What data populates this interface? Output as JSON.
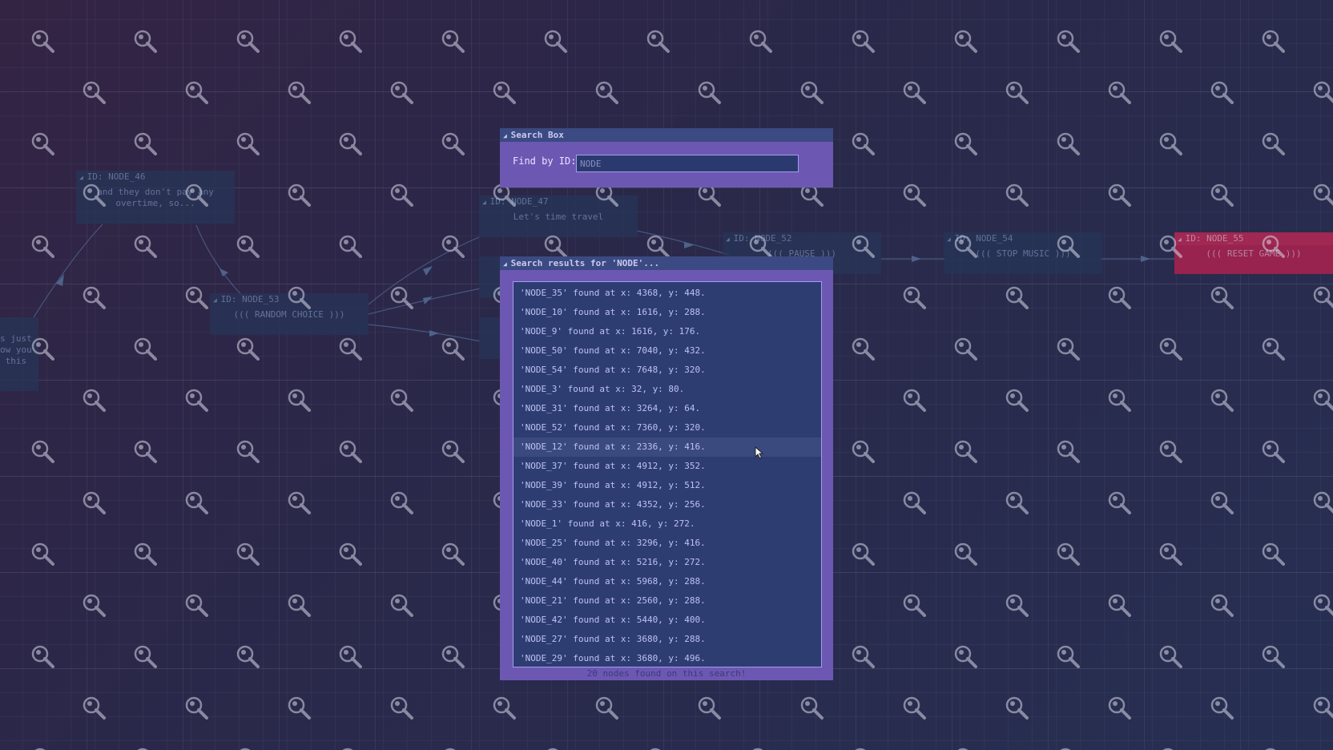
{
  "nodes": [
    {
      "id": "ID: NODE_46",
      "text": "and they don't pay any overtime, so..."
    },
    {
      "id": "ID: NODE_47",
      "text": "Let's time travel"
    },
    {
      "id": "ID: NODE_53",
      "text": "((( RANDOM CHOICE )))"
    },
    {
      "id": "ID: NODE_52",
      "text": "((( PAUSE )))"
    },
    {
      "id": "ID: NODE_54",
      "text": "((( STOP MUSIC )))"
    },
    {
      "id": "ID: NODE_55",
      "text": "((( RESET GAME )))"
    },
    {
      "id": "",
      "text": "s just\now you\n this"
    }
  ],
  "search_box": {
    "title": "Search Box",
    "label": "Find by ID:",
    "value": "NODE"
  },
  "results": {
    "title": "Search results for 'NODE'...",
    "items": [
      "'NODE_35' found at x: 4368, y: 448.",
      "'NODE_10' found at x: 1616, y: 288.",
      "'NODE_9' found at x: 1616, y: 176.",
      "'NODE_50' found at x: 7040, y: 432.",
      "'NODE_54' found at x: 7648, y: 320.",
      "'NODE_3' found at x: 32, y: 80.",
      "'NODE_31' found at x: 3264, y: 64.",
      "'NODE_52' found at x: 7360, y: 320.",
      "'NODE_12' found at x: 2336, y: 416.",
      "'NODE_37' found at x: 4912, y: 352.",
      "'NODE_39' found at x: 4912, y: 512.",
      "'NODE_33' found at x: 4352, y: 256.",
      "'NODE_1' found at x: 416, y: 272.",
      "'NODE_25' found at x: 3296, y: 416.",
      "'NODE_40' found at x: 5216, y: 272.",
      "'NODE_44' found at x: 5968, y: 288.",
      "'NODE_21' found at x: 2560, y: 288.",
      "'NODE_42' found at x: 5440, y: 400.",
      "'NODE_27' found at x: 3680, y: 288.",
      "'NODE_29' found at x: 3680, y: 496."
    ],
    "footer": "20 nodes found on this search!"
  },
  "colors": {
    "panel": "#6c58b3",
    "title_bar": "#3b4a82",
    "list_bg": "#2d3d72",
    "accent_red": "#c42352"
  },
  "icons": {
    "background_tile": "magnifier-icon",
    "cursor": "mouse-pointer-icon"
  }
}
